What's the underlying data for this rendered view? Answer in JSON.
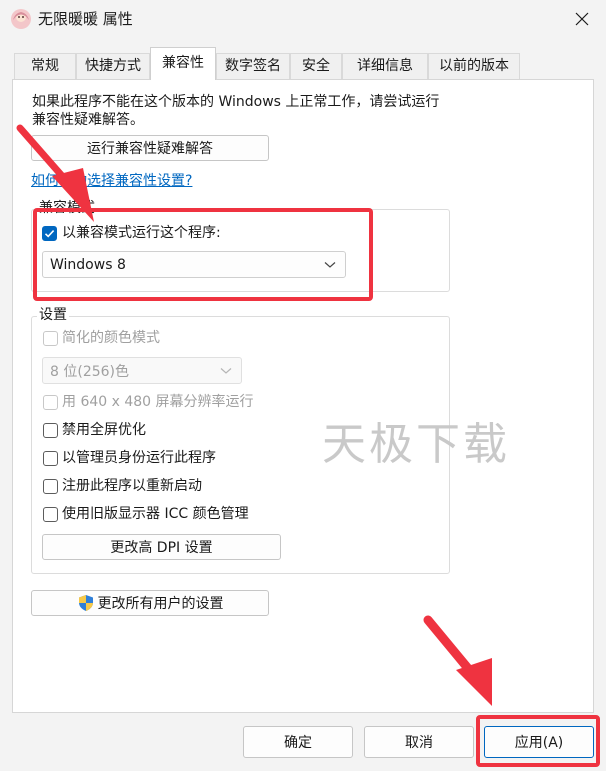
{
  "window": {
    "title": "无限暖暖 属性",
    "close_glyph": "✕"
  },
  "tabs": [
    {
      "label": "常规"
    },
    {
      "label": "快捷方式"
    },
    {
      "label": "兼容性"
    },
    {
      "label": "数字签名"
    },
    {
      "label": "安全"
    },
    {
      "label": "详细信息"
    },
    {
      "label": "以前的版本"
    }
  ],
  "active_tab": "兼容性",
  "compat": {
    "description": "如果此程序不能在这个版本的 Windows 上正常工作，请尝试运行兼容性疑难解答。",
    "troubleshoot_button": "运行兼容性疑难解答",
    "manual_link": "如何手动选择兼容性设置?",
    "mode_group_label": "兼容模式",
    "mode_checkbox_label": "以兼容模式运行这个程序:",
    "mode_checked": true,
    "mode_select_value": "Windows 8",
    "settings_group_label": "设置",
    "reduced_color_label": "简化的颜色模式",
    "color_select_value": "8 位(256)色",
    "resolution_label": "用 640 x 480 屏幕分辨率运行",
    "disable_fullscreen_label": "禁用全屏优化",
    "run_as_admin_label": "以管理员身份运行此程序",
    "register_restart_label": "注册此程序以重新启动",
    "legacy_icc_label": "使用旧版显示器 ICC 颜色管理",
    "dpi_button": "更改高 DPI 设置",
    "all_users_button": "更改所有用户的设置"
  },
  "watermark": "天极下载",
  "footer": {
    "ok": "确定",
    "cancel": "取消",
    "apply": "应用(A)"
  },
  "colors": {
    "accent": "#0067c0",
    "annotation": "#ef3340"
  }
}
